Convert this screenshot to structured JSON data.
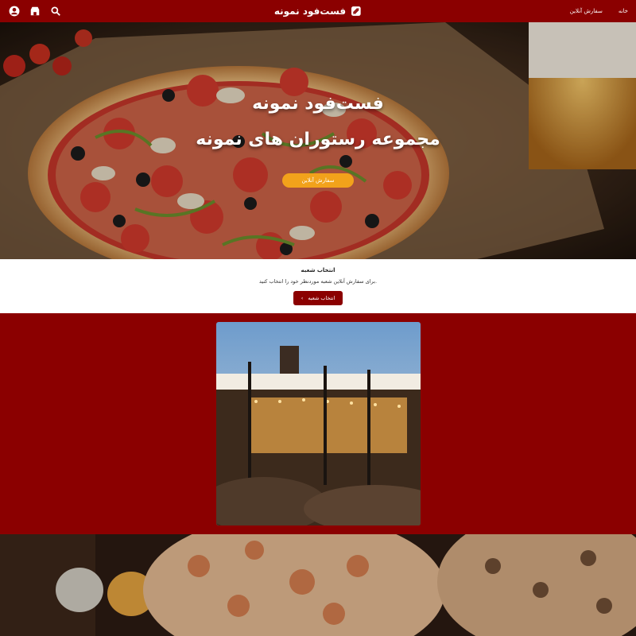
{
  "header": {
    "brand": "فست‌فود نمونه",
    "nav": [
      "خانه",
      "سفارش آنلاین"
    ]
  },
  "icons": {
    "search": "search-icon",
    "store": "store-icon",
    "account": "account-icon",
    "logo": "logo-icon"
  },
  "hero": {
    "title": "فست‌فود نمونه",
    "subtitle": "مجموعه رستوران های نمونه",
    "cta": "سفارش آنلاین"
  },
  "branch": {
    "title": "انتخاب شعبه",
    "description": "برای سفارش آنلاین شعبه موردنظر خود را انتخاب کنید.",
    "button": "انتخاب شعبه"
  },
  "colors": {
    "primary": "#8b0000",
    "accent": "#f2a21b"
  }
}
